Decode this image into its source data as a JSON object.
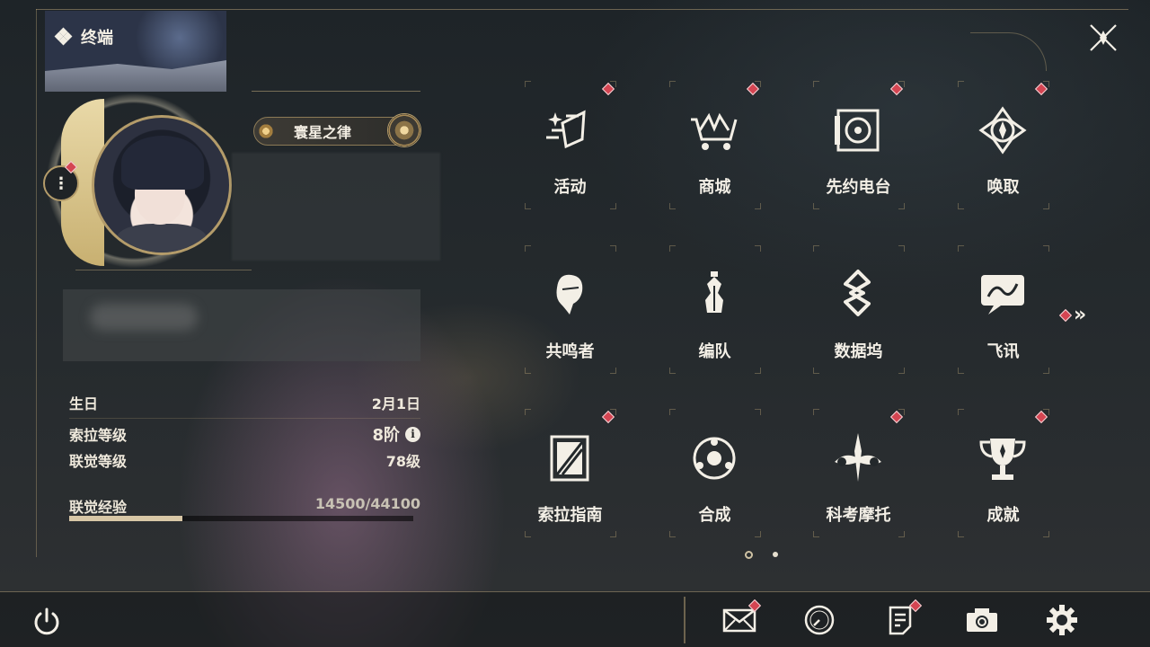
{
  "header": {
    "title": "终端"
  },
  "profile": {
    "title_badge": "寰星之律",
    "info": [
      {
        "label": "生日",
        "value": "2月1日"
      },
      {
        "label": "索拉等级",
        "value": "8阶"
      },
      {
        "label": "联觉等级",
        "value": "78级"
      }
    ],
    "info_icon_glyph": "i",
    "experience": {
      "label": "联觉经验",
      "value": "14500/44100",
      "fraction": 0.3288
    },
    "menu_glyph": "⋮"
  },
  "grid": {
    "items": [
      {
        "label": "活动",
        "icon": "activity-icon",
        "badge": true
      },
      {
        "label": "商城",
        "icon": "shop-cart-icon",
        "badge": true
      },
      {
        "label": "先约电台",
        "icon": "radio-icon",
        "badge": true
      },
      {
        "label": "唤取",
        "icon": "convene-icon",
        "badge": true
      },
      {
        "label": "共鸣者",
        "icon": "resonator-icon",
        "badge": false
      },
      {
        "label": "编队",
        "icon": "chess-team-icon",
        "badge": false
      },
      {
        "label": "数据坞",
        "icon": "data-bank-icon",
        "badge": false
      },
      {
        "label": "飞讯",
        "icon": "chat-message-icon",
        "badge": false
      },
      {
        "label": "索拉指南",
        "icon": "guidebook-icon",
        "badge": true
      },
      {
        "label": "合成",
        "icon": "synthesis-icon",
        "badge": false
      },
      {
        "label": "科考摩托",
        "icon": "motorbike-icon",
        "badge": true
      },
      {
        "label": "成就",
        "icon": "trophy-icon",
        "badge": true
      }
    ],
    "more_glyph": "»",
    "pages": {
      "current": 1,
      "total": 2
    }
  },
  "bottom_bar": {
    "icons": [
      "power-icon",
      "mail-icon",
      "clock-icon",
      "notice-icon",
      "camera-icon",
      "settings-gear-icon"
    ]
  },
  "colors": {
    "accent_gold": "#cdb482",
    "badge_red": "#d44552",
    "text": "#ece6d8"
  }
}
